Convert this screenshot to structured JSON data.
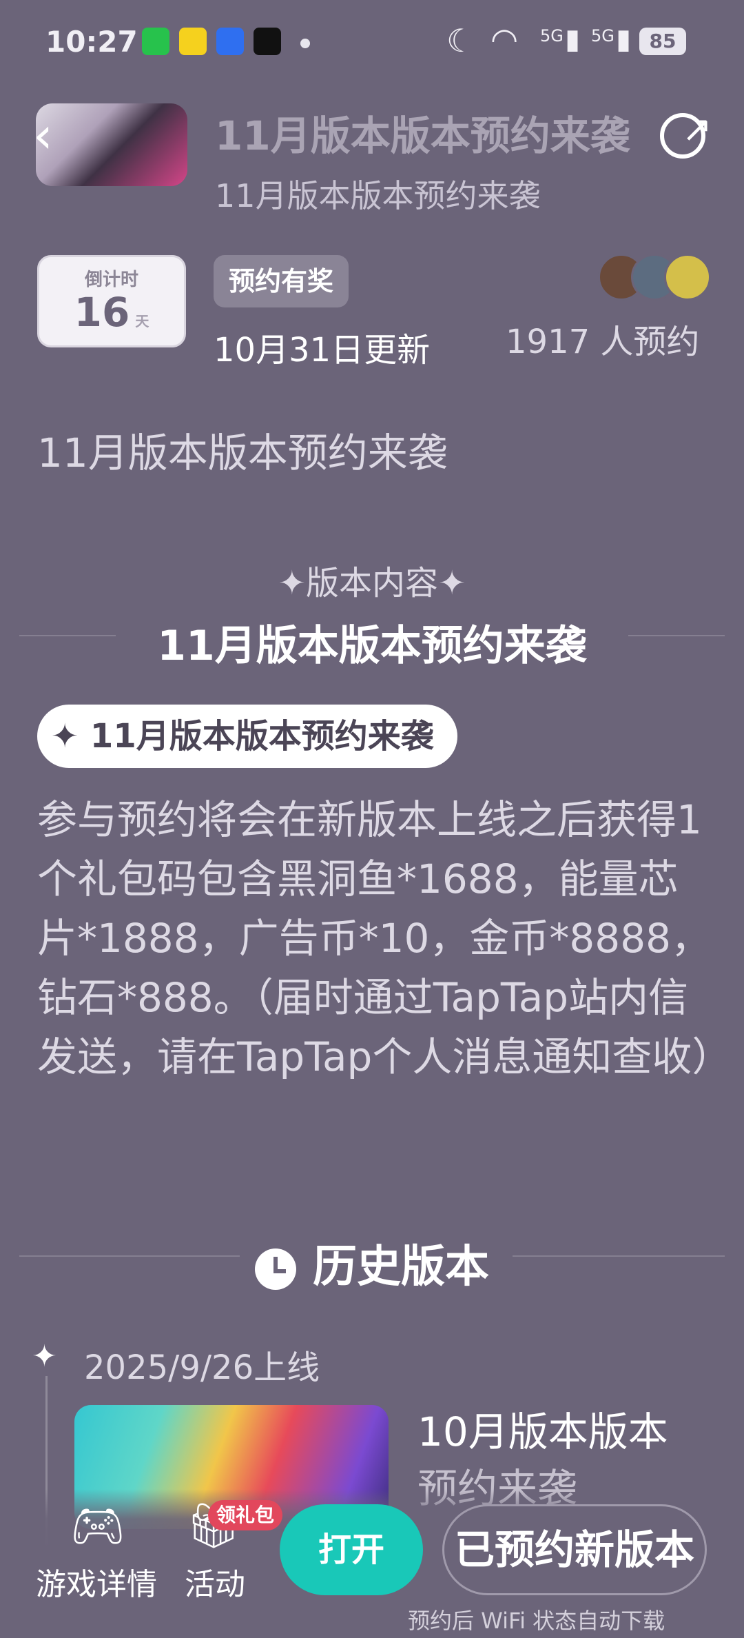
{
  "status_bar": {
    "time": "10:27",
    "signal1": "5G",
    "signal2": "5G",
    "battery": "85"
  },
  "header": {
    "title": "11月版本版本预约来袭",
    "subtitle": "11月版本版本预约来袭"
  },
  "countdown": {
    "label": "倒计时",
    "days": "16",
    "unit": "天"
  },
  "reward_badge": "预约有奖",
  "update_date": "10月31日更新",
  "reservation_count": "1917 人预约",
  "description": "11月版本版本预约来袭",
  "content_section": {
    "label": "✦版本内容✦",
    "title": "11月版本版本预约来袭",
    "pill": "✦ 11月版本版本预约来袭",
    "body": "参与预约将会在新版本上线之后获得1个礼包码包含黑洞鱼*1688，能量芯片*1888，广告币*10，金币*8888，钻石*888。（届时通过TapTap站内信发送，请在TapTap个人消息通知查收）"
  },
  "history": {
    "title": "历史版本",
    "items": [
      {
        "date": "2025/9/26上线",
        "name_line1": "10月版本版本",
        "name_line2": "预约来袭"
      }
    ]
  },
  "bottom_bar": {
    "game_details": "游戏详情",
    "activity": "活动",
    "gift_badge": "领礼包",
    "open": "打开",
    "reserved": "已预约新版本",
    "hint": "预约后 WiFi 状态自动下载"
  },
  "colors": {
    "background": "#6b6479",
    "accent": "#19c8b8",
    "badge_red": "#e2475c"
  }
}
